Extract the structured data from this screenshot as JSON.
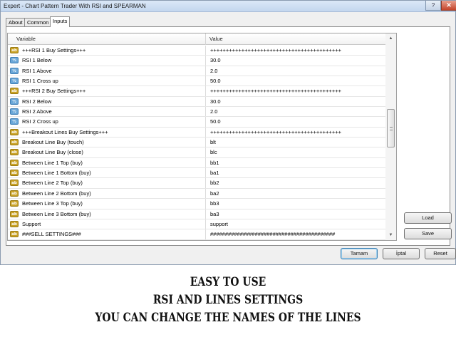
{
  "window": {
    "title": "Expert - Chart Pattern Trader With RSI and SPEARMAN",
    "help_label": "?",
    "close_label": "✕"
  },
  "tabs": [
    {
      "label": "About",
      "active": false
    },
    {
      "label": "Common",
      "active": false
    },
    {
      "label": "Inputs",
      "active": true
    }
  ],
  "grid": {
    "headers": {
      "variable": "Variable",
      "value": "Value"
    },
    "rows": [
      {
        "type": "ab",
        "variable": "+++RSI 1 Buy Settings+++",
        "value": "++++++++++++++++++++++++++++++++++++++++++"
      },
      {
        "type": "num",
        "variable": "RSI 1 Below",
        "value": "30.0"
      },
      {
        "type": "num",
        "variable": "RSI 1 Above",
        "value": "2.0"
      },
      {
        "type": "num",
        "variable": "RSI 1 Cross up",
        "value": "50.0"
      },
      {
        "type": "ab",
        "variable": "+++RSI 2 Buy Settings+++",
        "value": "++++++++++++++++++++++++++++++++++++++++++"
      },
      {
        "type": "num",
        "variable": "RSI 2 Below",
        "value": "30.0"
      },
      {
        "type": "num",
        "variable": "RSI 2 Above",
        "value": "2.0"
      },
      {
        "type": "num",
        "variable": "RSI 2 Cross up",
        "value": "50.0"
      },
      {
        "type": "ab",
        "variable": "+++Breakout Lines Buy Settings+++",
        "value": "++++++++++++++++++++++++++++++++++++++++++"
      },
      {
        "type": "ab",
        "variable": "Breakout Line Buy (touch)",
        "value": "blt"
      },
      {
        "type": "ab",
        "variable": "Breakout Line Buy (close)",
        "value": "blc"
      },
      {
        "type": "ab",
        "variable": "Between Line 1 Top (buy)",
        "value": "bb1"
      },
      {
        "type": "ab",
        "variable": "Between Line 1 Bottom (buy)",
        "value": "ba1"
      },
      {
        "type": "ab",
        "variable": "Between Line 2 Top (buy)",
        "value": "bb2"
      },
      {
        "type": "ab",
        "variable": "Between Line 2 Bottom (buy)",
        "value": "ba2"
      },
      {
        "type": "ab",
        "variable": "Between Line 3 Top (buy)",
        "value": "bb3"
      },
      {
        "type": "ab",
        "variable": "Between Line 3 Bottom (buy)",
        "value": "ba3"
      },
      {
        "type": "ab",
        "variable": "Support",
        "value": "support"
      },
      {
        "type": "ab",
        "variable": "###SELL SETTINGS###",
        "value": "##########################################"
      }
    ],
    "badges": {
      "ab": "ab",
      "num": "½"
    }
  },
  "scrollbar": {
    "up_icon": "▲",
    "down_icon": "▼"
  },
  "buttons": {
    "load": "Load",
    "save": "Save",
    "ok": "Tamam",
    "cancel": "İptal",
    "reset": "Reset"
  },
  "caption": {
    "line1": "EASY TO USE",
    "line2": "RSI AND LINES SETTINGS",
    "line3": "YOU CAN CHANGE THE NAMES OF THE LINES"
  }
}
